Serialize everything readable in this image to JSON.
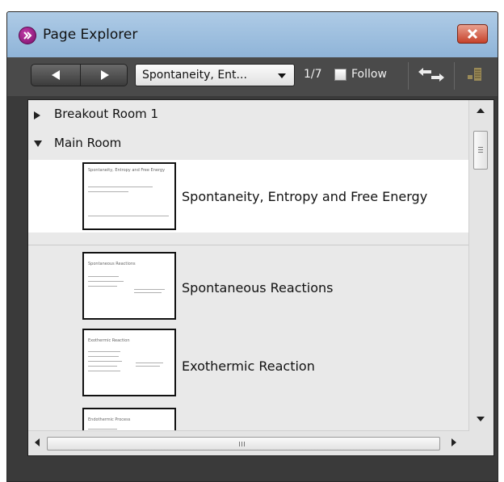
{
  "window": {
    "title": "Page Explorer",
    "icon": "app-logo-icon",
    "close_icon": "close-icon"
  },
  "toolbar": {
    "prev_icon": "arrow-left-icon",
    "next_icon": "arrow-right-icon",
    "page_select_value": "Spontaneity, Ent...",
    "page_count": "1/7",
    "follow_label": "Follow",
    "follow_checked": false,
    "sync_icon": "sync-arrows-icon",
    "list_icon": "page-list-icon"
  },
  "groups": [
    {
      "label": "Breakout Room 1",
      "expanded": false
    },
    {
      "label": "Main Room",
      "expanded": true
    }
  ],
  "pages": [
    {
      "label": "Spontaneity, Entropy and Free Energy",
      "selected": true,
      "thumb_title": "Spontaneity, Entropy and Free Energy"
    },
    {
      "label": "Spontaneous Reactions",
      "selected": false,
      "thumb_title": "Spontaneous Reactions"
    },
    {
      "label": "Exothermic Reaction",
      "selected": false,
      "thumb_title": "Exothermic Reaction"
    },
    {
      "label": "",
      "selected": false,
      "thumb_title": "Endothermic Process"
    }
  ],
  "colors": {
    "titlebar": "#9cbfe0",
    "toolbar": "#4a4a4a",
    "panel_bg": "#e9e9e9",
    "selected_row": "#ffffff",
    "close_button": "#d0563d"
  }
}
